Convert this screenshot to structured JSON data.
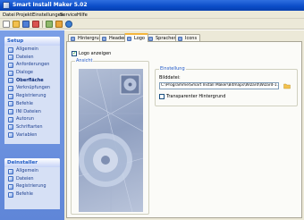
{
  "window": {
    "title": "Smart Install Maker 5.02"
  },
  "menu": [
    "Datei",
    "Projekt",
    "Einstellungen",
    "Service",
    "Hilfe"
  ],
  "toolbar": {
    "icons": [
      "new-icon",
      "open-icon",
      "save-icon",
      "save-all-icon",
      "settings-icon",
      "build-icon",
      "help-icon"
    ]
  },
  "sidebar": {
    "setup": {
      "header": "Setup",
      "items": [
        "Allgemein",
        "Dateien",
        "Anforderungen",
        "Dialoge",
        "Oberfläche",
        "Verknüpfungen",
        "Registrierung",
        "Befehle",
        "INI Dateien",
        "Autorun",
        "Schriftarten",
        "Variablen"
      ],
      "active": "Oberfläche"
    },
    "uninstaller": {
      "header": "Deinstaller",
      "items": [
        "Allgemein",
        "Dateien",
        "Registrierung",
        "Befehle"
      ]
    }
  },
  "tabs": [
    "Hintergrund",
    "Header",
    "Logo",
    "Sprachen",
    "Icons"
  ],
  "active_tab": "Logo",
  "logo_tab": {
    "show_logo_label": "Logo anzeigen",
    "show_logo_checked": true,
    "preview_group_title": "Ansicht",
    "settings_group_title": "Einstellung",
    "image_label": "Bilddatei:",
    "image_path": "C:\\Programme\\Smart Install Maker\\Bitmaps\\Wizard\\Wizard-1.bmp",
    "transparent_label": "Transparenter Hintergrund",
    "transparent_checked": false
  },
  "colors": {
    "titlebar": "#0a4cc8",
    "sidebar": "#6f93df",
    "panel_header_text": "#215dc6",
    "group_title": "#2058c8",
    "active_tab_accent": "#f4b53c"
  }
}
